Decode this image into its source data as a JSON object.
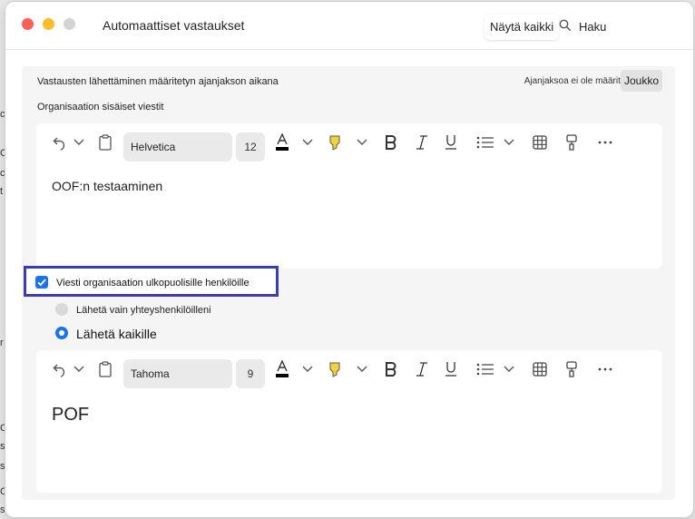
{
  "window": {
    "title": "Automaattiset vastaukset",
    "show_all_label": "Näytä kaikki",
    "search_label": "Haku"
  },
  "background_fragments": [
    "c",
    "s",
    "C",
    "c",
    "t",
    "r",
    "C",
    "s.",
    "C",
    "s",
    "C",
    "s."
  ],
  "period": {
    "label": "Vastausten lähettäminen määritetyn ajanjakson aikana",
    "value": "Ajanjaksoa ei ole määritetty",
    "group_button": "Joukko"
  },
  "internal": {
    "label": "Organisaation sisäiset viestit",
    "font": "Helvetica",
    "size": "12",
    "text": "OOF:n testaaminen"
  },
  "external": {
    "checkbox_label": "Viesti organisaation ulkopuolisille henkilöille",
    "checked": true,
    "option_contacts": "Lähetä vain yhteyshenkilöilleni",
    "option_all": "Lähetä kaikille",
    "selected_option": "option_all",
    "font": "Tahoma",
    "size": "9",
    "text": "POF"
  },
  "colors": {
    "accent": "#1a73e8",
    "highlight_box": "#3b3ab8",
    "highlighter": "#f2d43a",
    "font_color_bar": "#000000"
  },
  "toolbar_icons": [
    "undo-icon",
    "chevron-down-icon",
    "clipboard-icon",
    "font-color-icon",
    "highlighter-icon",
    "bold-icon",
    "italic-icon",
    "underline-icon",
    "bullet-list-icon",
    "table-icon",
    "format-painter-icon",
    "more-icon"
  ]
}
